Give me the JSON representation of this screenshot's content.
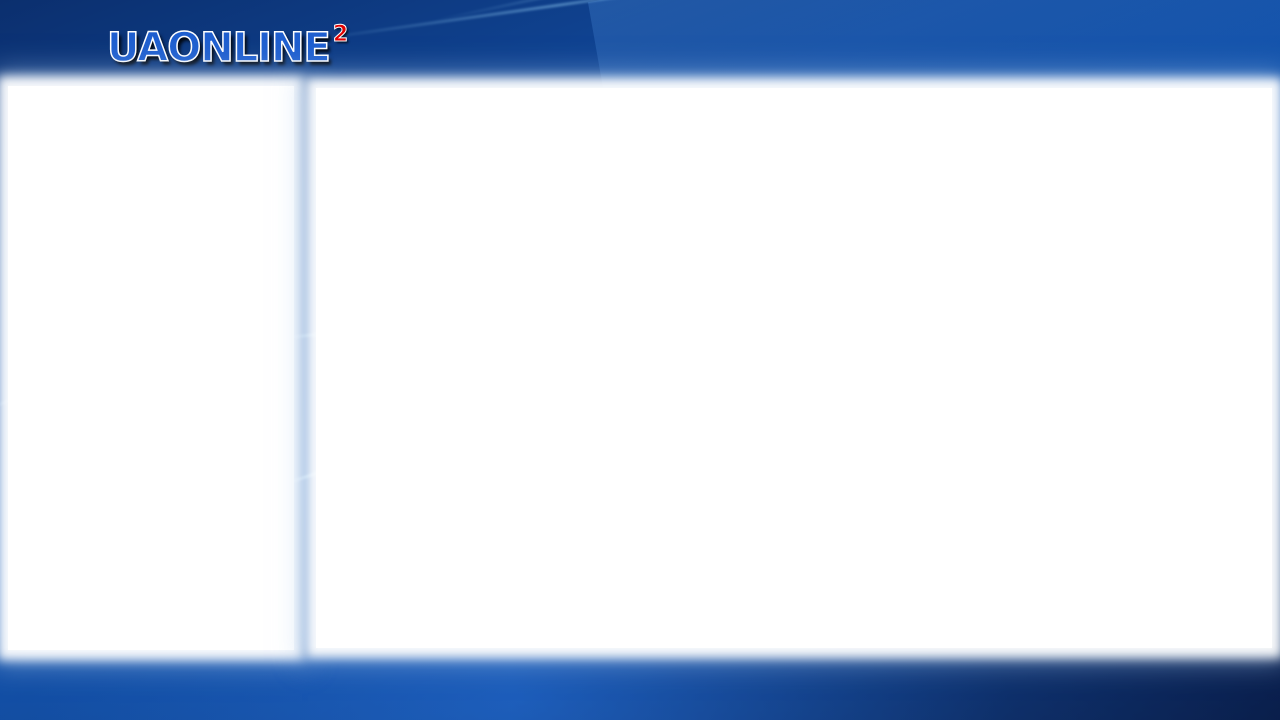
{
  "header": {
    "logo_text": "UAONLINE",
    "logo_superscript": "2"
  },
  "theme": {
    "background_primary": "#1456b0",
    "background_dark": "#0a1f45",
    "panel_color": "#ffffff",
    "logo_fill": "#1f5fcf",
    "logo_superscript_color": "#e00000"
  },
  "panels": {
    "left": {
      "name": "sidebar-panel"
    },
    "main": {
      "name": "content-panel"
    }
  }
}
